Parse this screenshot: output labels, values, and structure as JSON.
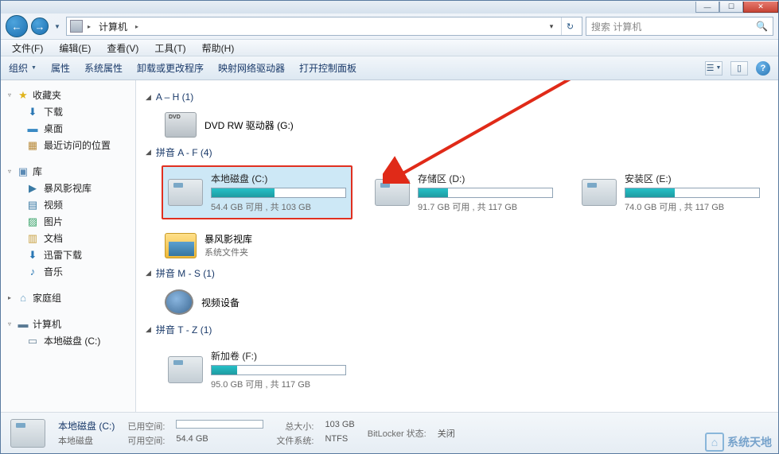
{
  "titlebar": {
    "min": "—",
    "max": "☐",
    "close": "✕"
  },
  "nav": {
    "back": "←",
    "fwd": "→",
    "drop": "▼"
  },
  "address": {
    "crumb_root": "计算机",
    "sep": "▸",
    "drop": "▾",
    "refresh": "↻"
  },
  "search": {
    "placeholder": "搜索 计算机",
    "icon": "🔍"
  },
  "menus": {
    "file": "文件(F)",
    "edit": "编辑(E)",
    "view": "查看(V)",
    "tools": "工具(T)",
    "help": "帮助(H)"
  },
  "toolbar": {
    "organize": "组织",
    "properties": "属性",
    "sysprops": "系统属性",
    "uninstall": "卸载或更改程序",
    "mapdrive": "映射网络驱动器",
    "controlpanel": "打开控制面板",
    "help": "?"
  },
  "sidebar": {
    "fav": {
      "label": "收藏夹",
      "downloads": "下载",
      "desktop": "桌面",
      "recent": "最近访问的位置"
    },
    "lib": {
      "label": "库",
      "baofeng": "暴风影视库",
      "video": "视频",
      "pictures": "图片",
      "docs": "文档",
      "xunlei": "迅雷下载",
      "music": "音乐"
    },
    "homegroup": {
      "label": "家庭组"
    },
    "computer": {
      "label": "计算机",
      "drive_c": "本地磁盘 (C:)"
    }
  },
  "cats": {
    "ah": {
      "title": "A – H (1)"
    },
    "af": {
      "title": "拼音 A - F (4)"
    },
    "ms": {
      "title": "拼音 M - S (1)"
    },
    "tz": {
      "title": "拼音 T - Z (1)"
    }
  },
  "items": {
    "dvd": {
      "title": "DVD RW 驱动器 (G:)"
    },
    "c": {
      "title": "本地磁盘 (C:)",
      "sub": "54.4 GB 可用 , 共 103 GB",
      "fill": 47
    },
    "d": {
      "title": "存储区 (D:)",
      "sub": "91.7 GB 可用 , 共 117 GB",
      "fill": 22
    },
    "e": {
      "title": "安装区 (E:)",
      "sub": "74.0 GB 可用 , 共 117 GB",
      "fill": 37
    },
    "bf": {
      "title": "暴风影视库",
      "sub": "系统文件夹"
    },
    "video": {
      "title": "视频设备"
    },
    "f": {
      "title": "新加卷 (F:)",
      "sub": "95.0 GB 可用 , 共 117 GB",
      "fill": 19
    }
  },
  "details": {
    "title": "本地磁盘 (C:)",
    "type": "本地磁盘",
    "used_lbl": "已用空间:",
    "free_lbl": "可用空间:",
    "free_val": "54.4 GB",
    "total_lbl": "总大小:",
    "total_val": "103 GB",
    "fs_lbl": "文件系统:",
    "fs_val": "NTFS",
    "bitlocker_lbl": "BitLocker 状态:",
    "bitlocker_val": "关闭"
  },
  "watermark": {
    "text": "系统天地"
  },
  "chart_data": [
    {
      "type": "bar",
      "title": "本地磁盘 (C:)",
      "categories": [
        "已用",
        "可用"
      ],
      "values": [
        48.6,
        54.4
      ],
      "ylabel": "GB",
      "ylim": [
        0,
        103
      ]
    },
    {
      "type": "bar",
      "title": "存储区 (D:)",
      "categories": [
        "已用",
        "可用"
      ],
      "values": [
        25.3,
        91.7
      ],
      "ylabel": "GB",
      "ylim": [
        0,
        117
      ]
    },
    {
      "type": "bar",
      "title": "安装区 (E:)",
      "categories": [
        "已用",
        "可用"
      ],
      "values": [
        43.0,
        74.0
      ],
      "ylabel": "GB",
      "ylim": [
        0,
        117
      ]
    },
    {
      "type": "bar",
      "title": "新加卷 (F:)",
      "categories": [
        "已用",
        "可用"
      ],
      "values": [
        22.0,
        95.0
      ],
      "ylabel": "GB",
      "ylim": [
        0,
        117
      ]
    }
  ]
}
